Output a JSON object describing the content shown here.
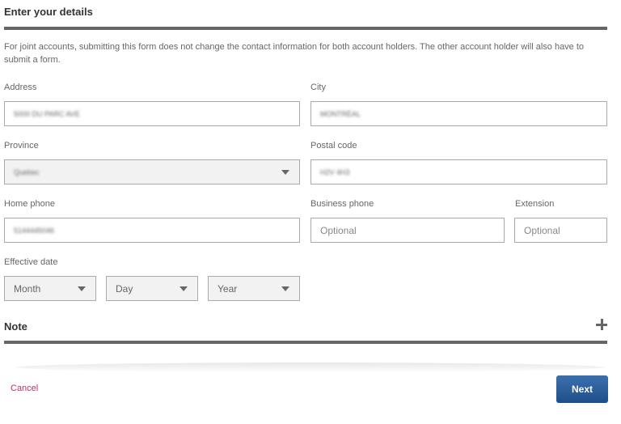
{
  "form": {
    "title": "Enter your details",
    "intro": "For joint accounts, submitting this form does not change the contact information for both account holders. The other account holder will also have to submit a form.",
    "address": {
      "label": "Address",
      "value": "5000 DU PARC AVE"
    },
    "city": {
      "label": "City",
      "value": "MONTRÉAL"
    },
    "province": {
      "label": "Province",
      "value": "Quebec"
    },
    "postal_code": {
      "label": "Postal code",
      "value": "H2V 4H3"
    },
    "home_phone": {
      "label": "Home phone",
      "value": "5144445046"
    },
    "business_phone": {
      "label": "Business phone",
      "placeholder": "Optional"
    },
    "extension": {
      "label": "Extension",
      "placeholder": "Optional"
    },
    "effective_date": {
      "label": "Effective date",
      "month": "Month",
      "day": "Day",
      "year": "Year"
    }
  },
  "note": {
    "title": "Note",
    "expand_icon": "plus-icon"
  },
  "actions": {
    "cancel": "Cancel",
    "next": "Next"
  },
  "colors": {
    "primary": "#2a5c99",
    "cancel": "#c0325c",
    "divider": "#666666"
  }
}
